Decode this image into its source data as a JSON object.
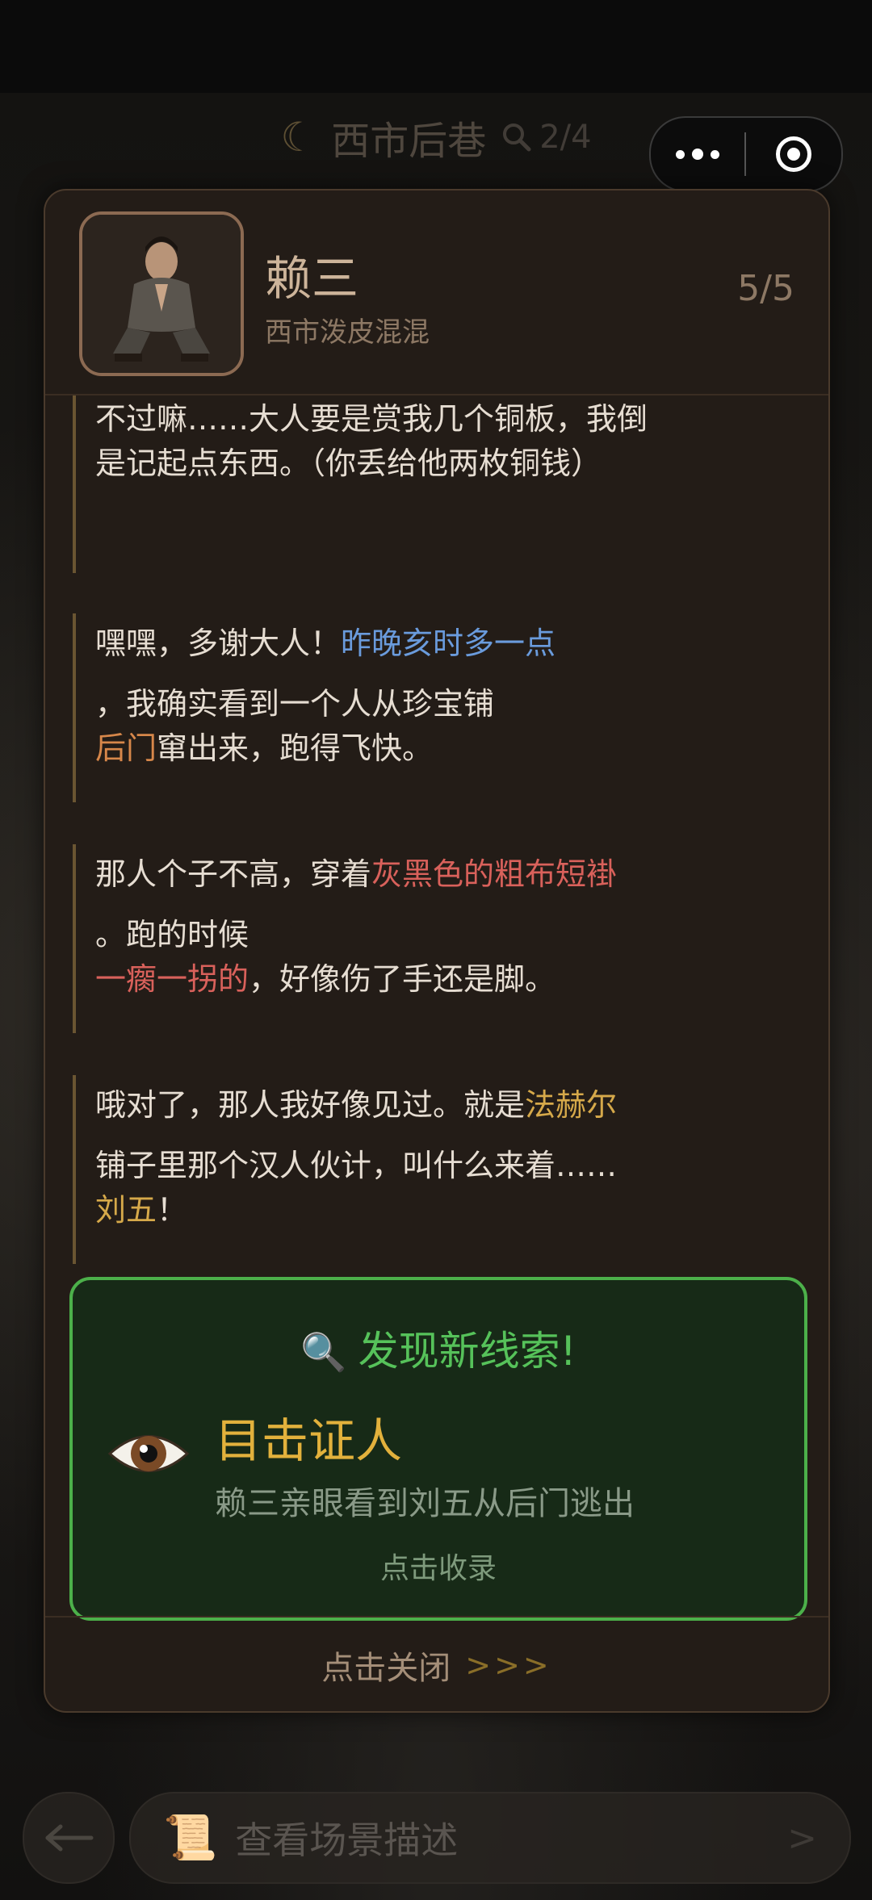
{
  "top_bar": {
    "location": "西市后巷",
    "clue_progress": "2/4",
    "moon_icon": "moon-icon",
    "search_icon": "magnifier-icon"
  },
  "mini_program": {
    "more_icon": "more-dots-icon",
    "close_icon": "target-circle-icon"
  },
  "dialog": {
    "character_name": "赖三",
    "character_title": "西市泼皮混混",
    "page_indicator": "5/5",
    "entries": [
      {
        "line1": "不过嘛……大人要是赏我几个铜板，我倒",
        "line2": "是记起点东西。（你丢给他两枚铜钱）"
      },
      {
        "line1_text": "嘿嘿，多谢大人！",
        "line1_hl": "昨晚亥时多一点",
        "line2": "，我确实看到一个人从珍宝铺",
        "line3_hl": "后门",
        "line3_text": "窜出来，跑得飞快。"
      },
      {
        "line1_text": "那人个子不高，穿着",
        "line1_hl": "灰黑色的粗布短褂",
        "line2": "。跑的时候",
        "line3_hl": "一瘸一拐的",
        "line3_text": "，好像伤了手还是脚。"
      },
      {
        "line1_text": "哦对了，那人我好像见过。就是",
        "line1_hl": "法赫尔",
        "line2": "铺子里那个汉人伙计，叫什么来着……",
        "line3_hl": "刘五",
        "line3_text": "！"
      }
    ],
    "clue": {
      "header": "发现新线索!",
      "name": "目击证人",
      "description": "赖三亲眼看到刘五从后门逃出",
      "collect_label": "点击收录",
      "icon": "eye-icon"
    },
    "close_label": "点击关闭",
    "close_arrows": ">>>"
  },
  "bottom_nav": {
    "back_icon": "arrow-left-icon",
    "scene_label": "查看场景描述",
    "scene_icon": "scroll-icon",
    "chevron": ">"
  },
  "colors": {
    "time_highlight": "#6a9bdc",
    "place_highlight": "#d7874a",
    "feature_highlight": "#d9615b",
    "name_highlight": "#d6a94a",
    "clue_accent": "#4cb04a"
  }
}
